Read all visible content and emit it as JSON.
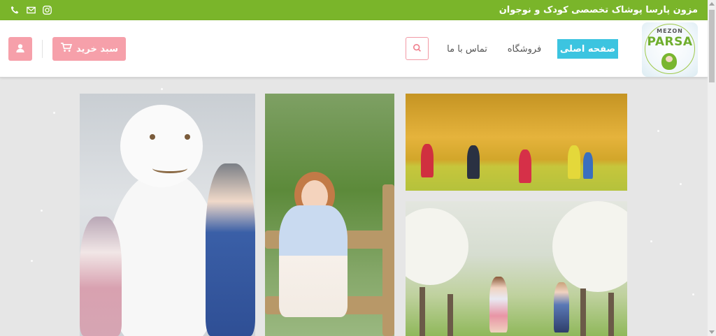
{
  "topbar": {
    "brand_text": "مزون پارسا پوشاک تخصصی کودک و نوجوان",
    "icons": [
      "instagram-icon",
      "mail-icon",
      "phone-icon"
    ]
  },
  "header": {
    "logo": {
      "top_text": "MEZON",
      "main_text": "PARSA"
    },
    "nav": {
      "home_label": "صفحه اصلی",
      "shop_label": "فروشگاه",
      "contact_label": "تماس با ما"
    },
    "cart_label": "سبد خرید",
    "icons": [
      "search-icon",
      "cart-icon",
      "user-icon"
    ]
  },
  "colors": {
    "topbar_green": "#7ab52a",
    "pink_accent": "#f6a0aa",
    "home_active": "#3cc4e0"
  },
  "gallery": {
    "photos": [
      "children-with-snowman-photo",
      "girl-leaning-on-fence-photo",
      "children-running-autumn-park-photo",
      "children-running-blossom-orchard-photo"
    ]
  }
}
